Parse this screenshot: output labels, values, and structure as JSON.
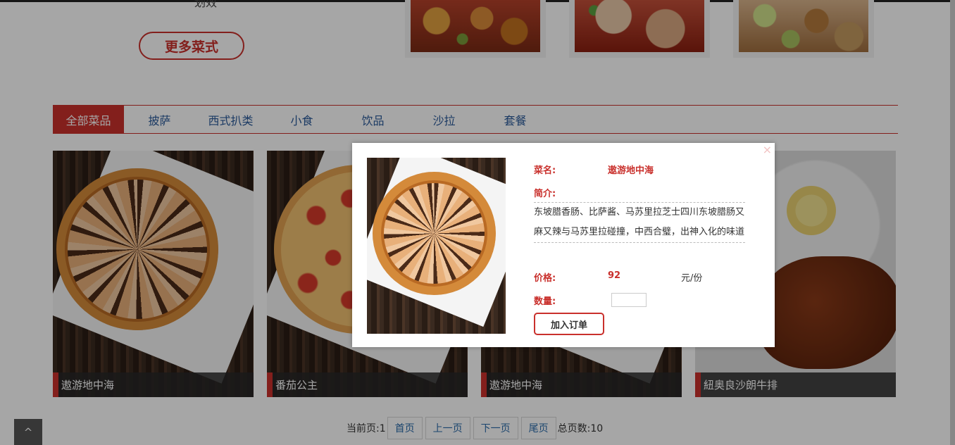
{
  "top": {
    "cut_text": "划效",
    "more_button": "更多菜式"
  },
  "tabs": [
    {
      "label": "全部菜品",
      "active": true
    },
    {
      "label": "披萨",
      "active": false
    },
    {
      "label": "西式扒类",
      "active": false
    },
    {
      "label": "小食",
      "active": false
    },
    {
      "label": "饮品",
      "active": false
    },
    {
      "label": "沙拉",
      "active": false
    },
    {
      "label": "套餐",
      "active": false
    }
  ],
  "products": [
    {
      "name": "遨游地中海"
    },
    {
      "name": "番茄公主"
    },
    {
      "name": "遨游地中海"
    },
    {
      "name": "紐奥良沙朗牛排"
    }
  ],
  "pager": {
    "current_label": "当前页:1",
    "first": "首页",
    "prev": "上一页",
    "next": "下一页",
    "last": "尾页",
    "total_label": "总页数:10"
  },
  "back_to_top": "^",
  "modal": {
    "close": "×",
    "name_label": "菜名:",
    "name_value": "遨游地中海",
    "intro_label": "简介:",
    "description": "东坡腊香肠、比萨酱、马苏里拉芝士四川东坡腊肠又麻又辣与马苏里拉碰撞，中西合璧，出神入化的味道",
    "price_label": "价格:",
    "price_value": "92",
    "price_unit": "元/份",
    "qty_label": "数量:",
    "qty_value": "",
    "add_button": "加入订单"
  },
  "colors": {
    "accent": "#c9302c",
    "tab_text": "#2a5a9a",
    "link": "#2a6aaa"
  }
}
